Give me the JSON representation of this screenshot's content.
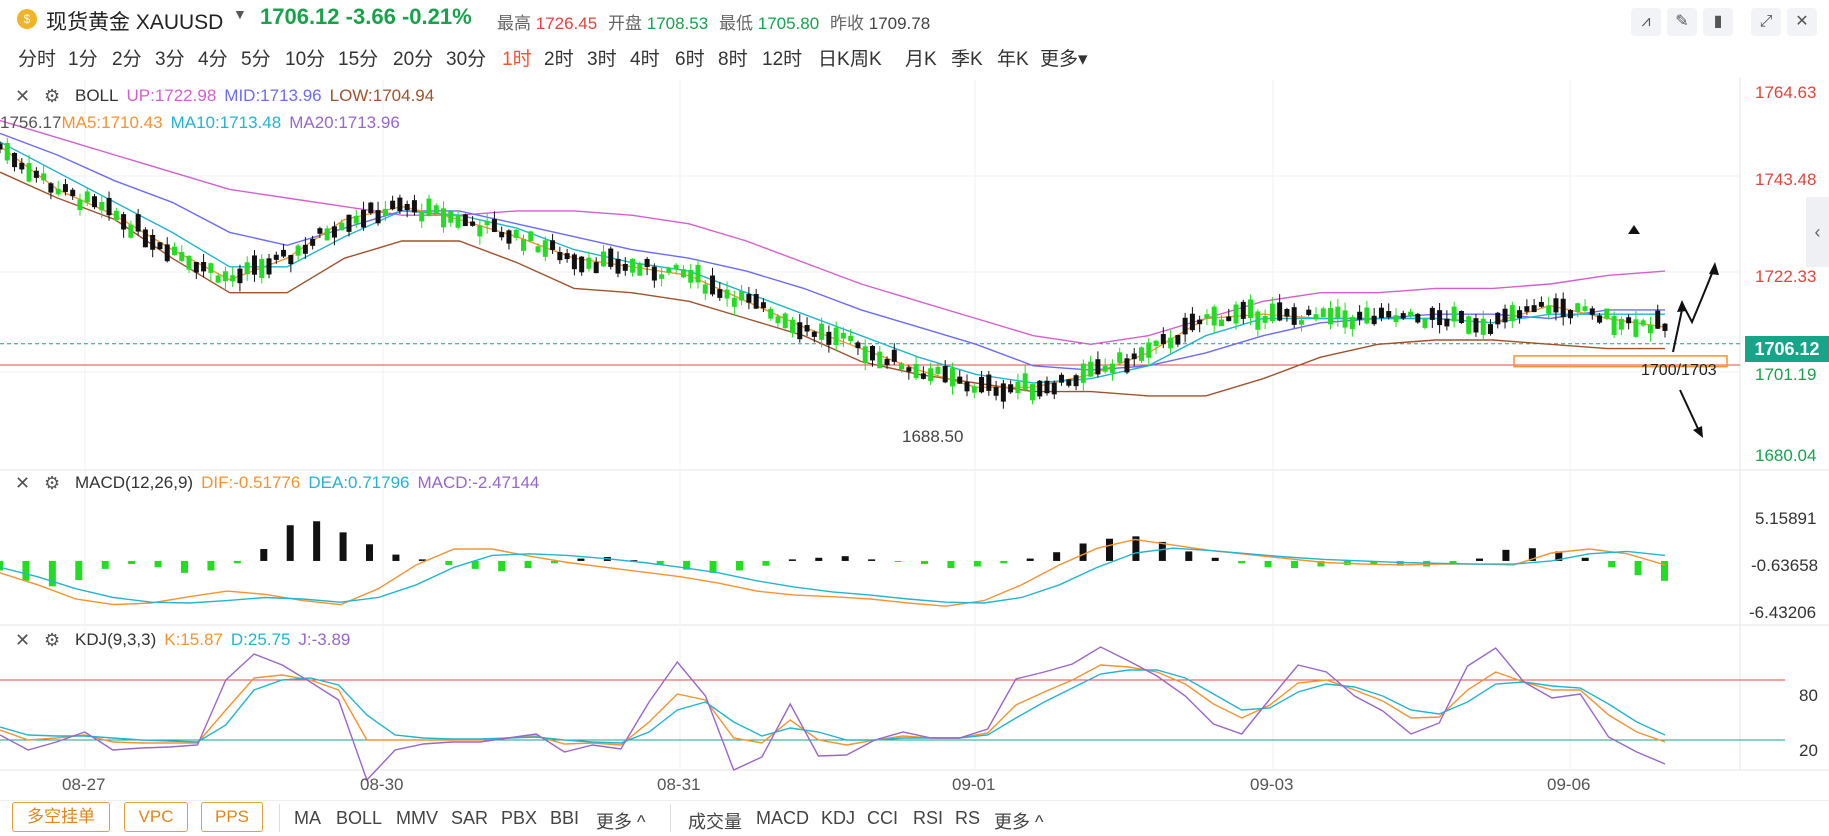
{
  "header": {
    "coin_icon": "gold-coin-icon",
    "symbol": "现货黄金 XAUUSD",
    "price": "1706.12",
    "change": "-3.66",
    "change_pct": "-0.21%",
    "high_label": "最高",
    "high": "1726.45",
    "open_label": "开盘",
    "open": "1708.53",
    "low_label": "最低",
    "low": "1705.80",
    "prev_label": "昨收",
    "prev": "1709.78"
  },
  "timeframes": [
    "分时",
    "1分",
    "2分",
    "3分",
    "4分",
    "5分",
    "10分",
    "15分",
    "20分",
    "30分",
    "1时",
    "2时",
    "3时",
    "4时",
    "6时",
    "8时",
    "12时",
    "日K",
    "周K",
    "月K",
    "季K",
    "年K",
    "更多"
  ],
  "active_timeframe": "1时",
  "main_legend": {
    "boll": "BOLL",
    "up": "UP:1722.98",
    "mid": "MID:1713.96",
    "low": "LOW:1704.94",
    "ma_prefix": "1756.17",
    "ma5": "MA5:1710.43",
    "ma10": "MA10:1713.48",
    "ma20": "MA20:1713.96"
  },
  "macd_legend": {
    "name": "MACD(12,26,9)",
    "dif": "DIF:-0.51776",
    "dea": "DEA:0.71796",
    "macd": "MACD:-2.47144"
  },
  "kdj_legend": {
    "name": "KDJ(9,3,3)",
    "k": "K:15.87",
    "d": "D:25.75",
    "j": "J:-3.89"
  },
  "price_axis": [
    "1764.63",
    "1743.48",
    "1722.33",
    "1701.19",
    "1680.04"
  ],
  "current_price_tag": "1706.12",
  "macd_axis": [
    "5.15891",
    "-0.63658",
    "-6.43206"
  ],
  "kdj_axis": [
    "80",
    "20"
  ],
  "x_labels": [
    "08-27",
    "08-30",
    "08-31",
    "09-01",
    "09-03",
    "09-06"
  ],
  "annotations": {
    "low_marker": "1688.50",
    "zone": "1700/1703"
  },
  "bottom": {
    "buttons": [
      "多空挂单",
      "VPC",
      "PPS"
    ],
    "main_indicators": [
      "MA",
      "BOLL",
      "MMV",
      "SAR",
      "PBX",
      "BBI",
      "更多"
    ],
    "sub_indicators": [
      "成交量",
      "MACD",
      "KDJ",
      "CCI",
      "RSI",
      "RS",
      "更多"
    ]
  },
  "colors": {
    "up": "#111111",
    "down": "#22dd22",
    "boll_up": "#d55fd0",
    "boll_mid": "#6b6bff",
    "boll_low": "#a0522d",
    "ma5": "#f59331",
    "ma10": "#22b5d0",
    "ma20": "#9966cc",
    "accent": "#f0542d",
    "green": "#16a34a"
  },
  "chart_data": [
    {
      "type": "candlestick",
      "title": "XAUUSD 1时",
      "ylim": [
        1680.04,
        1764.63
      ],
      "x_ticks": [
        "08-27",
        "08-30",
        "08-31",
        "09-01",
        "09-03",
        "09-06"
      ],
      "series": [
        {
          "name": "BOLL UP",
          "values": [
            1758,
            1754,
            1750,
            1746,
            1742,
            1740,
            1738,
            1736,
            1736,
            1737,
            1737,
            1736,
            1734,
            1730,
            1725,
            1720,
            1716,
            1712,
            1708,
            1706,
            1708,
            1712,
            1716,
            1718,
            1718,
            1719,
            1719,
            1720,
            1722,
            1723
          ]
        },
        {
          "name": "BOLL MID",
          "values": [
            1755,
            1750,
            1744,
            1739,
            1732,
            1729,
            1733,
            1737,
            1737,
            1734,
            1731,
            1728,
            1726,
            1723,
            1719,
            1714,
            1710,
            1706,
            1701,
            1700,
            1701,
            1704,
            1708,
            1711,
            1712,
            1713,
            1713,
            1712,
            1714,
            1714
          ]
        },
        {
          "name": "BOLL LOW",
          "values": [
            1746,
            1740,
            1735,
            1726,
            1718,
            1718,
            1726,
            1730,
            1730,
            1725,
            1719,
            1718,
            1716,
            1712,
            1708,
            1702,
            1699,
            1697,
            1695,
            1695,
            1694,
            1694,
            1698,
            1703,
            1706,
            1707,
            1707,
            1706,
            1705,
            1705
          ]
        },
        {
          "name": "MA5",
          "values": [
            1752,
            1742,
            1736,
            1728,
            1721,
            1726,
            1735,
            1738,
            1735,
            1731,
            1726,
            1724,
            1722,
            1716,
            1710,
            1705,
            1700,
            1696,
            1696,
            1699,
            1704,
            1712,
            1713,
            1712,
            1712,
            1712,
            1711,
            1715,
            1712,
            1710
          ]
        },
        {
          "name": "MA10",
          "values": [
            1753,
            1746,
            1739,
            1732,
            1724,
            1724,
            1731,
            1737,
            1736,
            1733,
            1728,
            1725,
            1723,
            1718,
            1713,
            1708,
            1703,
            1699,
            1697,
            1698,
            1701,
            1708,
            1712,
            1712,
            1712,
            1712,
            1711,
            1713,
            1713,
            1713
          ]
        }
      ],
      "annotations": [
        "1688.50",
        "1700/1703"
      ]
    },
    {
      "type": "bar",
      "title": "MACD(12,26,9)",
      "ylim": [
        -6.43206,
        5.15891
      ],
      "values": [
        -1.2,
        -2.5,
        -3.2,
        -2.4,
        -1.0,
        -0.4,
        -0.8,
        -1.5,
        -1.2,
        -0.3,
        1.5,
        4.5,
        5.0,
        3.6,
        2.1,
        0.8,
        0.2,
        -0.5,
        -1.0,
        -1.3,
        -0.9,
        -0.3,
        0.3,
        0.5,
        0.1,
        -0.5,
        -1.1,
        -1.5,
        -1.2,
        -0.6,
        0.2,
        0.4,
        0.6,
        0.2,
        -0.1,
        -0.4,
        -0.9,
        -0.7,
        -0.3,
        0.3,
        1.1,
        2.2,
        2.8,
        3.1,
        2.4,
        1.2,
        0.4,
        -0.3,
        -0.8,
        -0.9,
        -0.7,
        -0.5,
        -0.4,
        -0.6,
        -0.7,
        -0.4,
        0.3,
        1.4,
        1.6,
        1.2,
        0.4,
        -0.8,
        -1.8,
        -2.5
      ],
      "series": [
        {
          "name": "DIF",
          "values": [
            -1.5,
            -3.0,
            -4.8,
            -5.5,
            -5.3,
            -4.5,
            -3.8,
            -4.2,
            -5.0,
            -5.5,
            -3.5,
            -0.5,
            1.5,
            1.5,
            0.6,
            -0.2,
            -0.8,
            -1.4,
            -2.0,
            -2.8,
            -3.8,
            -4.3,
            -4.5,
            -4.8,
            -5.3,
            -5.7,
            -5.0,
            -3.0,
            -0.5,
            1.6,
            2.7,
            2.0,
            1.3,
            0.8,
            0.3,
            -0.2,
            -0.4,
            -0.5,
            -0.4,
            -0.4,
            -0.5,
            1.0,
            1.5,
            0.9,
            -0.5
          ]
        },
        {
          "name": "DEA",
          "values": [
            -0.8,
            -2.0,
            -3.5,
            -4.6,
            -5.2,
            -5.3,
            -5.0,
            -4.6,
            -4.8,
            -5.2,
            -4.6,
            -3.0,
            -0.8,
            0.7,
            0.9,
            0.7,
            0.3,
            -0.2,
            -0.8,
            -1.5,
            -2.5,
            -3.3,
            -3.9,
            -4.3,
            -4.8,
            -5.2,
            -5.3,
            -4.6,
            -3.0,
            -0.8,
            1.0,
            1.6,
            1.3,
            0.9,
            0.5,
            0.2,
            0.0,
            -0.2,
            -0.3,
            -0.4,
            -0.4,
            0.0,
            0.9,
            1.2,
            0.7
          ]
        }
      ]
    },
    {
      "type": "line",
      "title": "KDJ(9,3,3)",
      "ylim": [
        0,
        100
      ],
      "series": [
        {
          "name": "K",
          "values": [
            30,
            20,
            22,
            25,
            18,
            17,
            17,
            17,
            50,
            82,
            85,
            80,
            70,
            20,
            20,
            20,
            20,
            20,
            22,
            24,
            16,
            17,
            15,
            38,
            66,
            60,
            22,
            17,
            40,
            20,
            15,
            20,
            24,
            22,
            22,
            27,
            55,
            68,
            80,
            95,
            93,
            88,
            76,
            56,
            42,
            55,
            77,
            80,
            70,
            59,
            42,
            43,
            70,
            88,
            78,
            70,
            70,
            45,
            28,
            18
          ]
        },
        {
          "name": "D",
          "values": [
            33,
            25,
            24,
            24,
            22,
            20,
            19,
            18,
            35,
            70,
            80,
            82,
            75,
            45,
            25,
            22,
            21,
            21,
            22,
            23,
            20,
            18,
            17,
            28,
            50,
            58,
            38,
            24,
            32,
            28,
            20,
            20,
            22,
            22,
            22,
            25,
            42,
            58,
            72,
            86,
            90,
            90,
            82,
            66,
            50,
            52,
            68,
            76,
            73,
            64,
            50,
            46,
            58,
            76,
            78,
            74,
            72,
            56,
            38,
            25
          ]
        },
        {
          "name": "J",
          "values": [
            25,
            10,
            18,
            28,
            10,
            12,
            13,
            15,
            80,
            106,
            95,
            78,
            60,
            -20,
            10,
            16,
            18,
            18,
            22,
            26,
            8,
            15,
            11,
            58,
            98,
            64,
            -10,
            3,
            56,
            4,
            5,
            20,
            28,
            22,
            22,
            31,
            81,
            88,
            96,
            113,
            99,
            84,
            64,
            36,
            26,
            61,
            95,
            88,
            64,
            49,
            26,
            37,
            94,
            112,
            78,
            62,
            66,
            23,
            8,
            -4
          ]
        }
      ]
    }
  ]
}
